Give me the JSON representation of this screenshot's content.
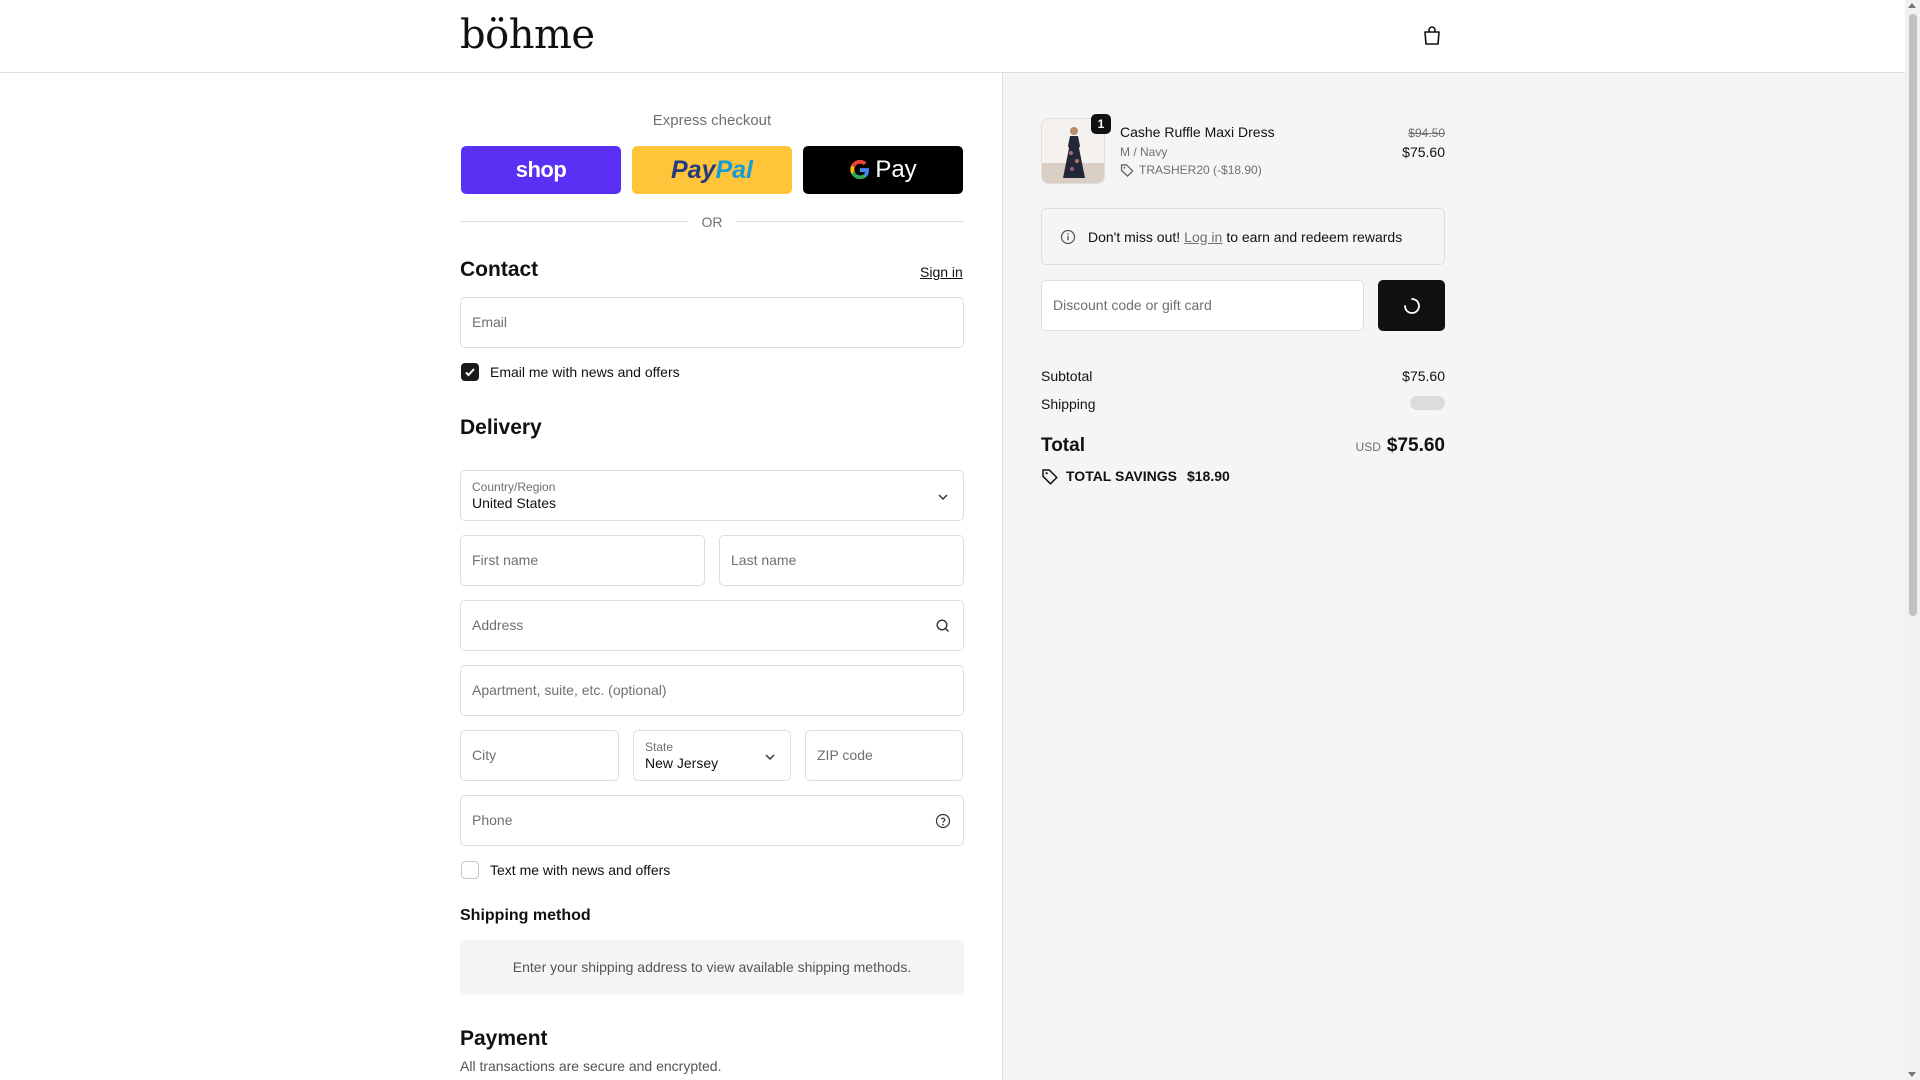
{
  "header": {
    "logo": "böhme",
    "bag_icon": "shopping-bag-icon"
  },
  "express": {
    "title": "Express checkout",
    "buttons": [
      {
        "label": "shop",
        "color": "#5a31f4"
      },
      {
        "label_part1": "Pay",
        "label_part2": "Pal",
        "color": "#ffc439"
      },
      {
        "label": "Pay",
        "color": "#000000"
      }
    ],
    "divider": "OR"
  },
  "contact": {
    "heading": "Contact",
    "sign_in": "Sign in",
    "email_placeholder": "Email",
    "news_checkbox": {
      "label": "Email me with news and offers",
      "checked": true
    }
  },
  "delivery": {
    "heading": "Delivery",
    "country": {
      "label": "Country/Region",
      "value": "United States"
    },
    "first_name": "First name",
    "last_name": "Last name",
    "address": "Address",
    "apartment": "Apartment, suite, etc. (optional)",
    "city": "City",
    "state": {
      "label": "State",
      "value": "New Jersey"
    },
    "zip": "ZIP code",
    "phone": "Phone",
    "text_checkbox": {
      "label": "Text me with news and offers",
      "checked": false
    }
  },
  "shipping_method": {
    "heading": "Shipping method",
    "message": "Enter your shipping address to view available shipping methods."
  },
  "payment": {
    "heading": "Payment",
    "subtitle": "All transactions are secure and encrypted."
  },
  "order": {
    "item": {
      "quantity": "1",
      "name": "Cashe Ruffle Maxi Dress",
      "variant": "M / Navy",
      "discount": "TRASHER20 (-$18.90)",
      "original_price": "$94.50",
      "price": "$75.60"
    },
    "rewards": {
      "prefix": "Don't miss out!",
      "link": "Log in",
      "suffix": "to earn and redeem rewards"
    },
    "discount_placeholder": "Discount code or gift card",
    "subtotal_label": "Subtotal",
    "subtotal": "$75.60",
    "shipping_label": "Shipping",
    "total_label": "Total",
    "currency": "USD",
    "total": "$75.60",
    "savings_label": "TOTAL SAVINGS",
    "savings": "$18.90"
  },
  "colors": {
    "accent": "#1a1a1a",
    "shop": "#5a31f4",
    "paypal": "#ffc439",
    "panel_bg": "#f5f5f5"
  }
}
